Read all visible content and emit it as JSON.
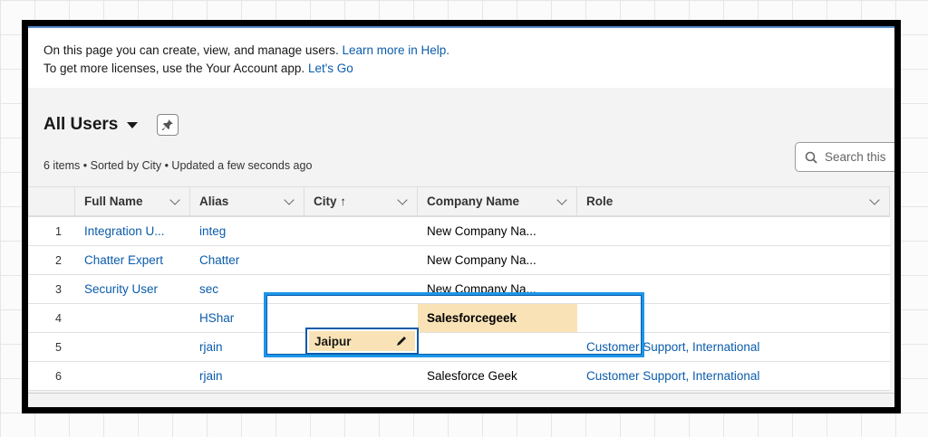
{
  "info": {
    "line1": "On this page you can create, view, and manage users.",
    "help_link": "Learn more in Help.",
    "line2": "To get more licenses, use the Your Account app.",
    "go_link": "Let's Go"
  },
  "list": {
    "title": "All Users",
    "meta": "6 items • Sorted by City • Updated a few seconds ago",
    "search_placeholder": "Search this"
  },
  "columns": [
    "",
    "Full Name",
    "Alias",
    "City ↑",
    "Company Name",
    "Role"
  ],
  "rows": [
    {
      "n": "1",
      "name": "Integration U...",
      "alias": "integ",
      "city": "",
      "company": "New Company Na...",
      "role": ""
    },
    {
      "n": "2",
      "name": "Chatter Expert",
      "alias": "Chatter",
      "city": "",
      "company": "New Company Na...",
      "role": ""
    },
    {
      "n": "3",
      "name": "Security User",
      "alias": "sec",
      "city": "",
      "company": "New Company Na...",
      "role": ""
    },
    {
      "n": "4",
      "name": "",
      "alias": "HShar",
      "city": "",
      "company": "Salesforcegeek",
      "role": ""
    },
    {
      "n": "5",
      "name": "",
      "alias": "rjain",
      "city": "Jaipur",
      "company": "",
      "role": "Customer Support, International"
    },
    {
      "n": "6",
      "name": "",
      "alias": "rjain",
      "city": "",
      "company": "Salesforce Geek",
      "role": "Customer Support, International"
    }
  ]
}
